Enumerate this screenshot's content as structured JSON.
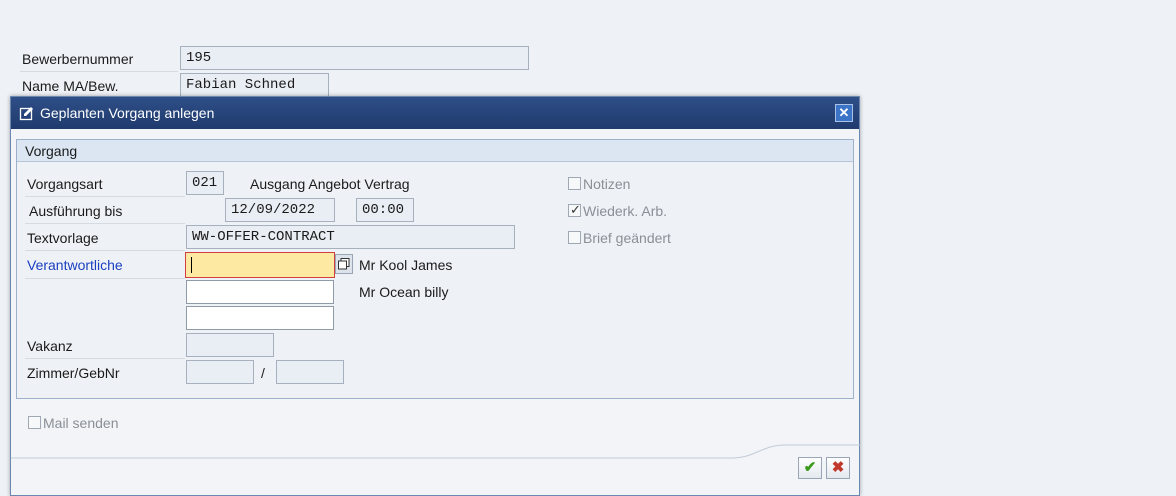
{
  "background_form": {
    "applicant_number_label": "Bewerbernummer",
    "applicant_number_value": "195",
    "name_label": "Name MA/Bew.",
    "name_value": "Fabian Schned"
  },
  "dialog": {
    "title": "Geplanten Vorgang anlegen",
    "close_symbol": "✕",
    "group_title": "Vorgang",
    "fields": {
      "activity_type_label": "Vorgangsart",
      "activity_type_value": "021",
      "activity_type_text": "Ausgang Angebot Vertrag",
      "execution_label": "Ausführung bis",
      "execution_date": "12/09/2022",
      "execution_time": "00:00",
      "template_label": "Textvorlage",
      "template_value": "WW-OFFER-CONTRACT",
      "responsible_label": "Verantwortliche",
      "responsible_1_value": "",
      "responsible_1_name": "Mr Kool James",
      "responsible_2_value": "",
      "responsible_2_name": "Mr Ocean billy",
      "responsible_3_value": "",
      "vacancy_label": "Vakanz",
      "vacancy_value": "",
      "room_label": "Zimmer/GebNr",
      "room_value": "",
      "room_separator": "/",
      "building_value": ""
    },
    "checkboxes": {
      "notes_label": "Notizen",
      "notes_checked": false,
      "recurring_label": "Wiederk. Arb.",
      "recurring_checked": true,
      "letter_changed_label": "Brief geändert",
      "letter_changed_checked": false,
      "send_mail_label": "Mail senden",
      "send_mail_checked": false
    },
    "buttons": {
      "confirm_symbol": "✔",
      "cancel_symbol": "✖"
    },
    "colors": {
      "title_bar": "#1f3a6d",
      "link_label": "#1b3fbf",
      "focus_field": "#fde9a2",
      "confirm_green": "#3a9a1a",
      "cancel_red": "#c0392b"
    }
  }
}
